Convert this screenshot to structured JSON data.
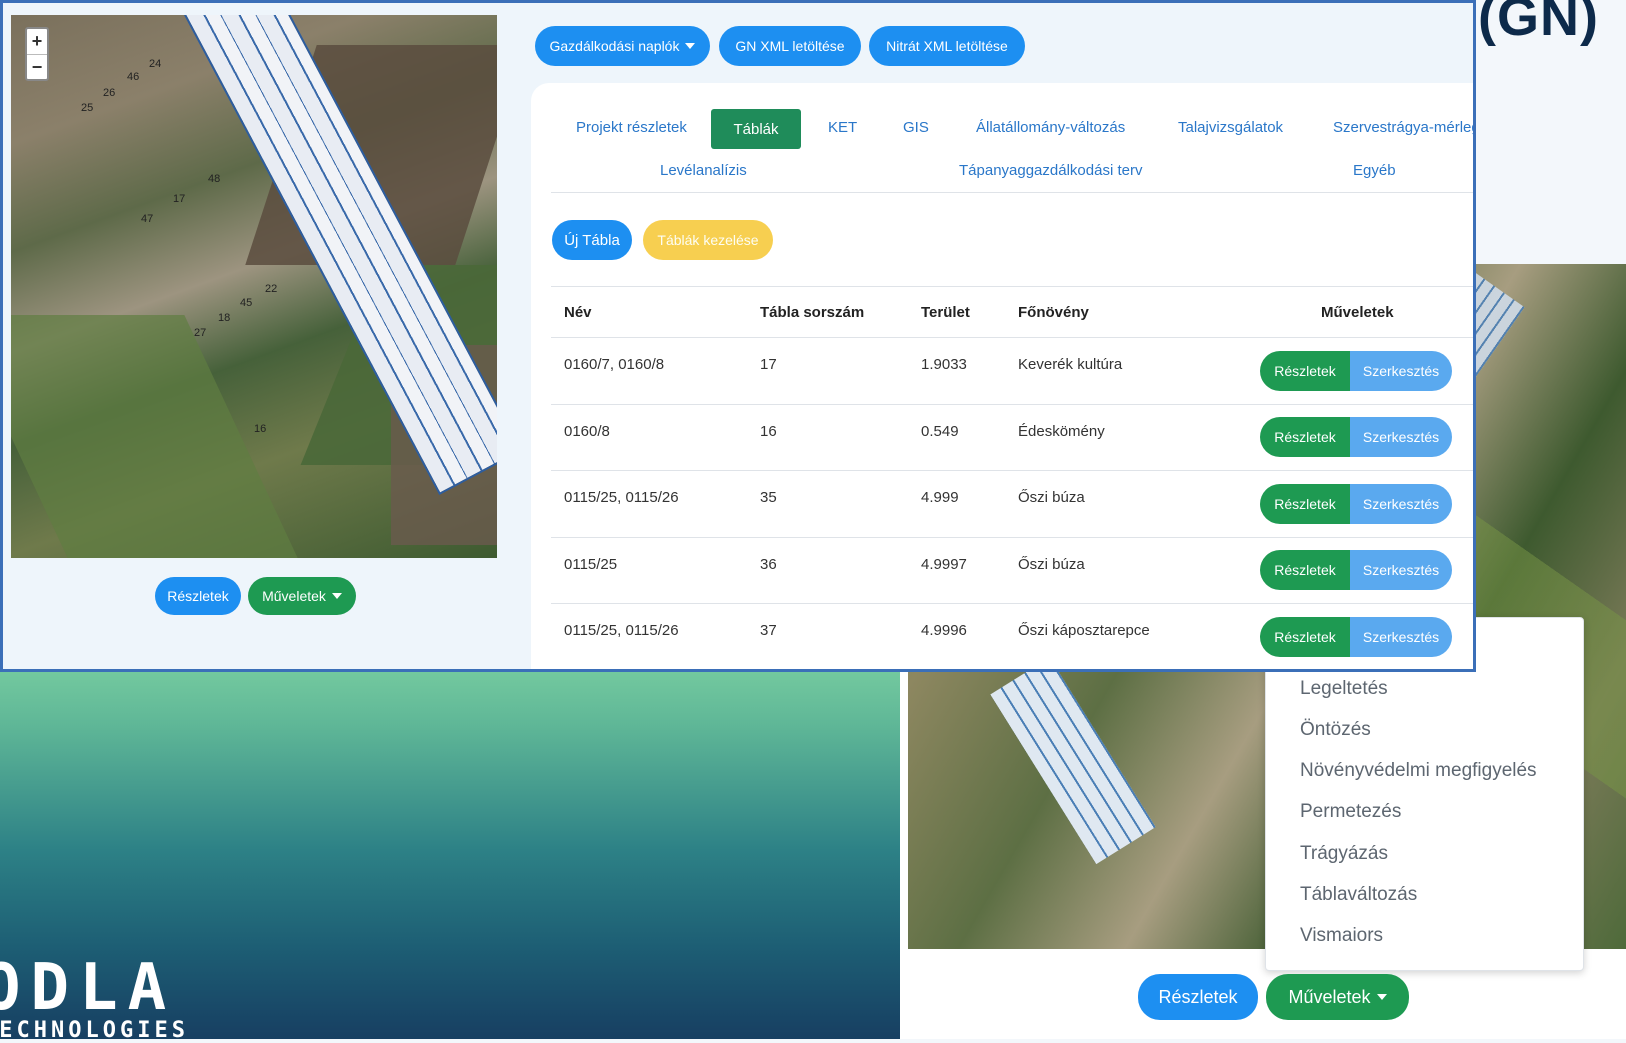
{
  "corner_title": "(GN)",
  "logo": {
    "big": "ODLA",
    "small": "TECHNOLOGIES"
  },
  "front": {
    "top_buttons": {
      "logs": "Gazdálkodási naplók",
      "gn_xml": "GN XML letöltése",
      "nitrat_xml": "Nitrát XML letöltése"
    },
    "map": {
      "zoom_in": "+",
      "zoom_out": "−",
      "field_labels": [
        "24",
        "26",
        "46",
        "25",
        "17",
        "48",
        "47",
        "22",
        "45",
        "18",
        "27",
        "16"
      ]
    },
    "map_buttons": {
      "details": "Részletek",
      "operations": "Műveletek"
    },
    "tabs": {
      "row1": [
        "Projekt részletek",
        "Táblák",
        "KET",
        "GIS",
        "Állatállomány-változás",
        "Talajvizsgálatok",
        "Szervestrágya-mérleg"
      ],
      "row2": [
        "Levélanalízis",
        "Tápanyaggazdálkodási terv",
        "Egyéb"
      ],
      "active": "Táblák"
    },
    "actions": {
      "new_table": "Új Tábla",
      "manage_tables": "Táblák kezelése"
    },
    "table": {
      "headers": [
        "Név",
        "Tábla sorszám",
        "Terület",
        "Főnövény",
        "Műveletek"
      ],
      "rows": [
        {
          "name": "0160/7, 0160/8",
          "number": "17",
          "area": "1.9033",
          "crop": "Keverék kultúra"
        },
        {
          "name": "0160/8",
          "number": "16",
          "area": "0.549",
          "crop": "Édeskömény"
        },
        {
          "name": "0115/25, 0115/26",
          "number": "35",
          "area": "4.999",
          "crop": "Őszi búza"
        },
        {
          "name": "0115/25",
          "number": "36",
          "area": "4.9997",
          "crop": "Őszi búza"
        },
        {
          "name": "0115/25, 0115/26",
          "number": "37",
          "area": "4.9996",
          "crop": "Őszi káposztarepce"
        }
      ],
      "row_button_details": "Részletek",
      "row_button_edit": "Szerkesztés"
    }
  },
  "back": {
    "dropdown_items": [
      "Legeltetés",
      "Öntözés",
      "Növényvédelmi megfigyelés",
      "Permetezés",
      "Trágyázás",
      "Táblaváltozás",
      "Vismaiors"
    ],
    "buttons": {
      "details": "Részletek",
      "operations": "Műveletek"
    }
  },
  "colors": {
    "primary_blue": "#1d8ff1",
    "success_green": "#1e9a52",
    "warning_yellow": "#f7cf50",
    "light_blue": "#5aa9ef",
    "frame_border": "#3b6fb8"
  }
}
